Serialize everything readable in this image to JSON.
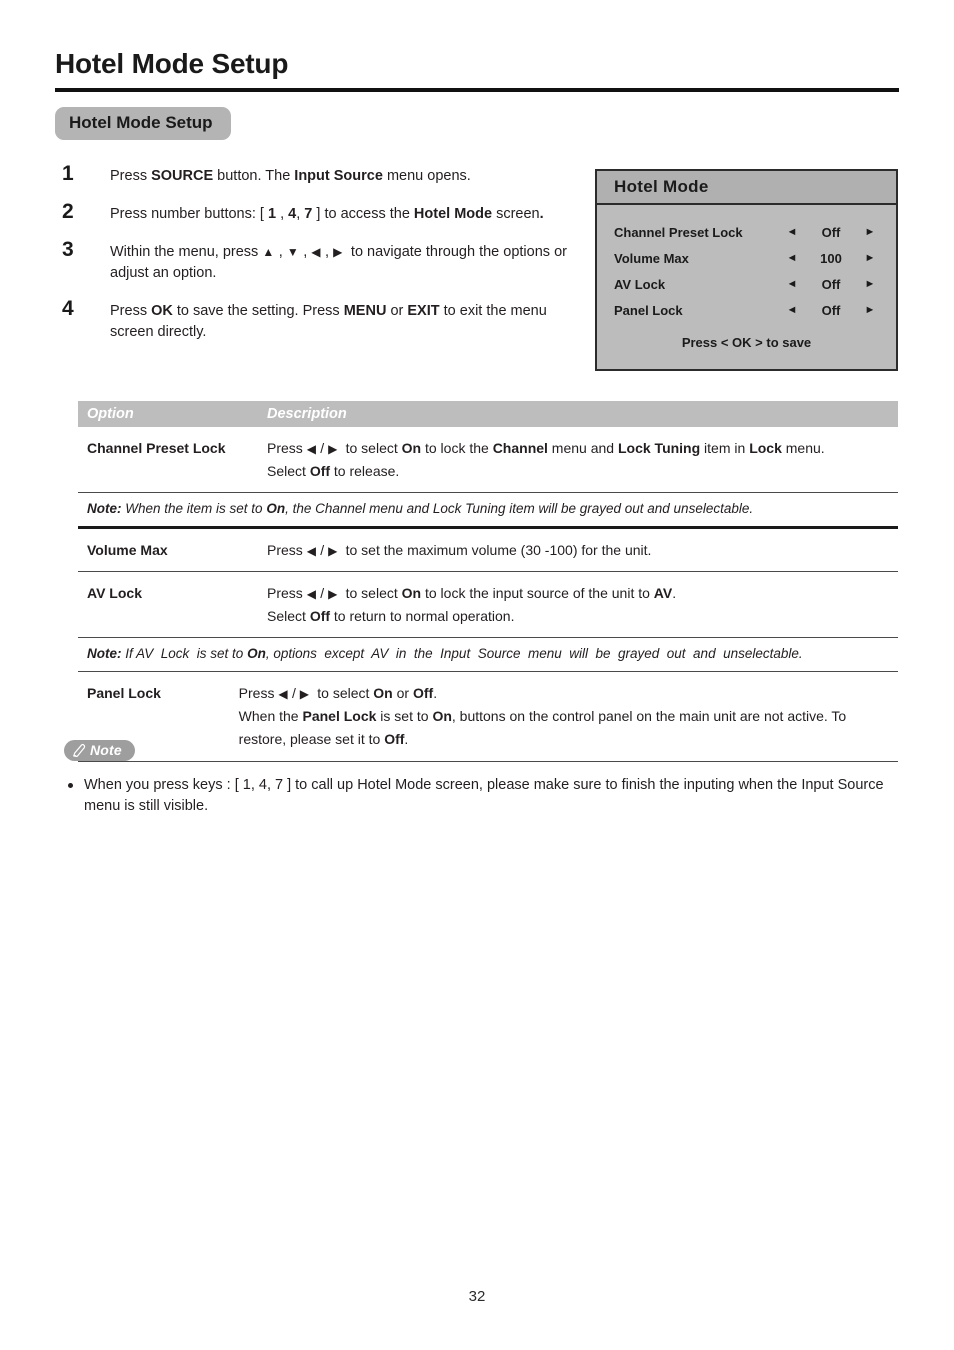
{
  "header": {
    "title": "Hotel Mode Setup",
    "section_badge": "Hotel Mode Setup"
  },
  "steps": [
    {
      "number": "1",
      "html": "Press <b>SOURCE</b> button. The <b>Input Source</b> menu opens."
    },
    {
      "number": "2",
      "html": "Press number buttons: [ <b>1</b> , <b>4</b>, <b>7</b> ] to access the <b>Hotel Mode</b> screen<b>.</b>"
    },
    {
      "number": "3",
      "html": "Within the menu, press <span class=\"arrow-glyph\">&#9650;</span> , <span class=\"arrow-glyph\">&#9660;</span> , <span class=\"arrow-glyph\">&#9664;</span> , <span class=\"arrow-glyph\">&#9654;</span>&nbsp; to navigate through the options or adjust an option."
    },
    {
      "number": "4",
      "html": "Press <b>OK</b> to save the setting. Press <b>MENU</b> or <b>EXIT</b> to exit the menu screen directly."
    }
  ],
  "osd": {
    "title": "Hotel  Mode",
    "left_arrow": "◄",
    "right_arrow": "►",
    "rows": [
      {
        "label": "Channel Preset Lock",
        "value": "Off"
      },
      {
        "label": "Volume Max",
        "value": "100"
      },
      {
        "label": "AV Lock",
        "value": "Off"
      },
      {
        "label": "Panel Lock",
        "value": "Off"
      }
    ],
    "footer": "Press < OK > to save",
    "bg_color": "#bcbcbc",
    "header_color": "#b0b0b0",
    "border_color": "#2b2b2b"
  },
  "table": {
    "headers": {
      "option": "Option",
      "description": "Description"
    },
    "header_bg": "#bdbdbd",
    "rows": [
      {
        "option": "Channel Preset Lock",
        "description_html": "Press <span class=\"arrow-glyph\">&#9664;</span> / <span class=\"arrow-glyph\">&#9654;</span>&nbsp; to select <b>On</b> to lock the <b>Channel</b> menu and <b>Lock Tuning</b> item in <b>Lock</b> menu.<br>Select <b>Off</b> to release.",
        "note_html": "<span class=\"nlabel\">Note:</span> When the item is set to <b>On</b>, the Channel menu and Lock Tuning item will be grayed out and unselectable."
      },
      {
        "option": "Volume Max",
        "description_html": "Press <span class=\"arrow-glyph\">&#9664;</span> / <span class=\"arrow-glyph\">&#9654;</span>&nbsp; to set the maximum volume (30 -100) for the unit.",
        "note_html": ""
      },
      {
        "option": "AV Lock",
        "description_html": "Press <span class=\"arrow-glyph\">&#9664;</span> / <span class=\"arrow-glyph\">&#9654;</span>&nbsp; to select <b>On</b> to lock the input source of the unit to <b>AV</b>.<br>Select <b>Off</b> to return to normal operation.",
        "note_html": "<span class=\"nlabel\">Note:</span> If AV&nbsp; Lock&nbsp; is set to <b>On</b>, options&nbsp; except&nbsp; AV&nbsp; in&nbsp; the&nbsp; Input&nbsp; Source&nbsp; menu&nbsp; will&nbsp; be&nbsp; grayed&nbsp; out&nbsp; and&nbsp; unselectable."
      },
      {
        "option": "Panel Lock",
        "description_html": "Press <span class=\"arrow-glyph\">&#9664;</span> / <span class=\"arrow-glyph\">&#9654;</span>&nbsp; to select <b>On</b> or <b>Off</b>.<br>When the <b>Panel Lock</b> is set to <b>On</b>, buttons on the control panel on the main unit are not active. To restore, please set it to <b>Off</b>.",
        "note_html": ""
      }
    ]
  },
  "note_block": {
    "badge_label": "Note",
    "badge_icon": "pencil-icon",
    "items": [
      "When you press keys : [ 1, 4, 7 ] to call up Hotel Mode screen, please make sure to finish the inputing when the Input Source menu is still visible."
    ]
  },
  "footer": {
    "page_number": "32"
  }
}
